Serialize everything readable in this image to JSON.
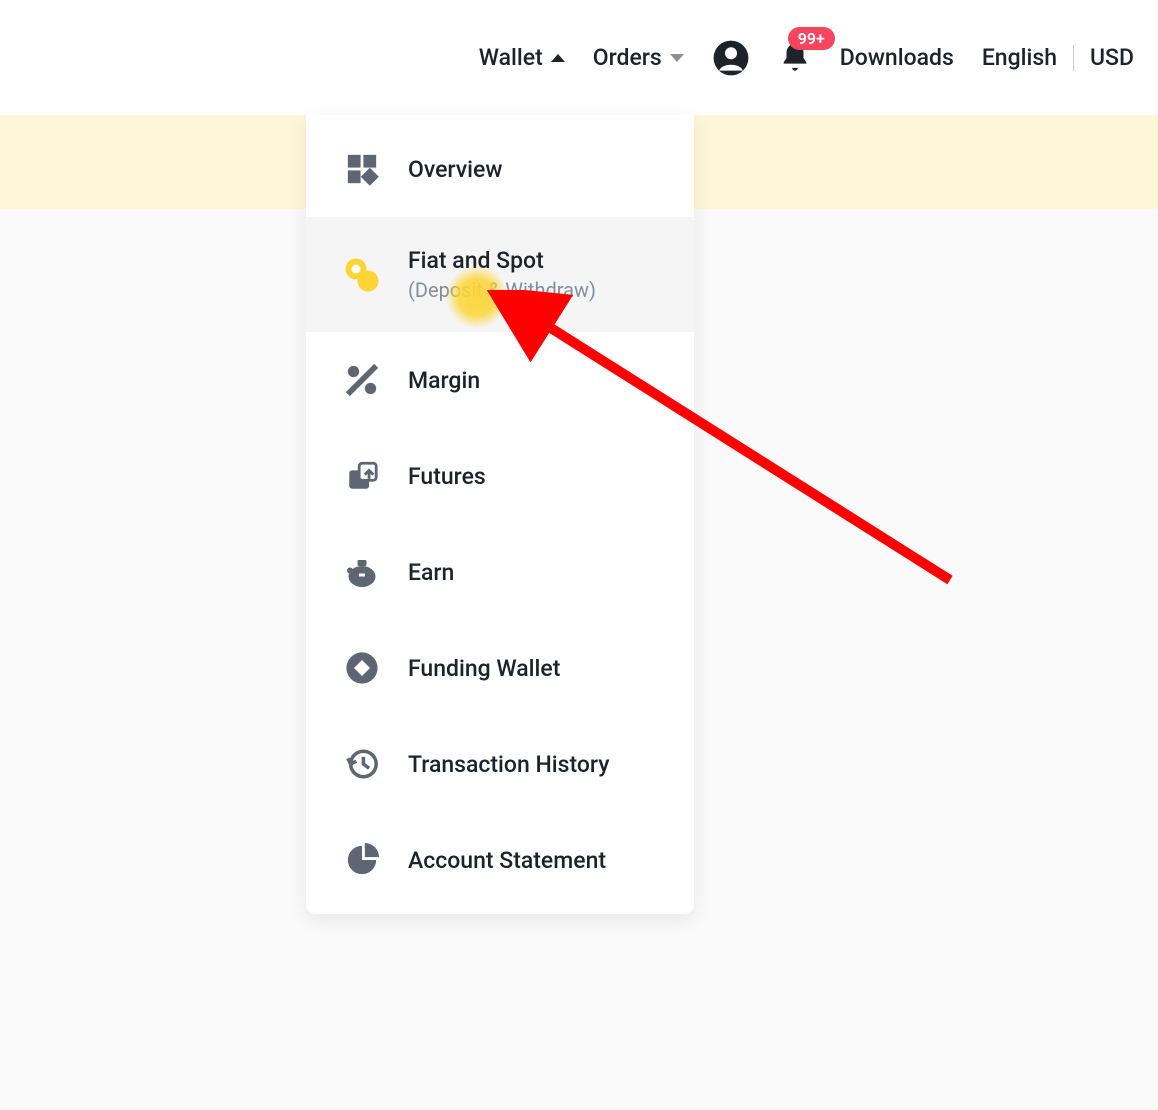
{
  "header": {
    "wallet_label": "Wallet",
    "orders_label": "Orders",
    "downloads_label": "Downloads",
    "language": "English",
    "currency": "USD",
    "notification_badge": "99+"
  },
  "dropdown": {
    "items": [
      {
        "label": "Overview",
        "sub": "",
        "icon": "overview-icon"
      },
      {
        "label": "Fiat and Spot",
        "sub": "(Deposit & Withdraw)",
        "icon": "fiat-spot-icon"
      },
      {
        "label": "Margin",
        "sub": "",
        "icon": "margin-icon"
      },
      {
        "label": "Futures",
        "sub": "",
        "icon": "futures-icon"
      },
      {
        "label": "Earn",
        "sub": "",
        "icon": "earn-icon"
      },
      {
        "label": "Funding Wallet",
        "sub": "",
        "icon": "funding-wallet-icon"
      },
      {
        "label": "Transaction History",
        "sub": "",
        "icon": "transaction-history-icon"
      },
      {
        "label": "Account Statement",
        "sub": "",
        "icon": "account-statement-icon"
      }
    ]
  },
  "annotation": {
    "highlight_color": "#fcd535",
    "arrow_color": "#ff0000"
  }
}
